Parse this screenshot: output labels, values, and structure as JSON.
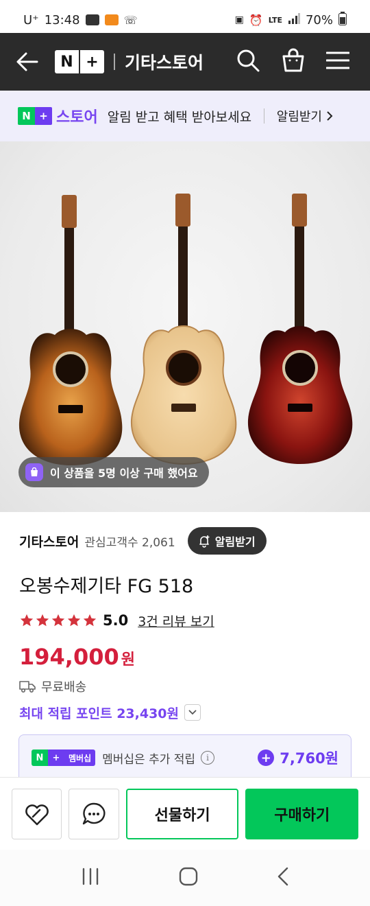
{
  "status_bar": {
    "carrier": "U⁺",
    "time": "13:48",
    "network": "LTE",
    "battery": "70%"
  },
  "header": {
    "logo_left": "N",
    "logo_right": "+",
    "title": "기타스토어"
  },
  "promo": {
    "logo_left": "N",
    "logo_right": "+",
    "store_label": "스토어",
    "message": "알림 받고 혜택 받아보세요",
    "notify_label": "알림받기"
  },
  "hero": {
    "purchase_badge": "이 상품을 5명 이상 구매 했어요"
  },
  "store": {
    "name": "기타스토어",
    "fans": "관심고객수 2,061",
    "alarm_label": "알림받기"
  },
  "product": {
    "title": "오봉수제기타 FG 518",
    "rating": 5.0,
    "rating_text": "5.0",
    "review_link": "3건 리뷰 보기",
    "price": "194,000",
    "currency": "원",
    "shipping": "무료배송",
    "max_points": "최대 적립 포인트 23,430원"
  },
  "membership": {
    "badge_g": "N",
    "badge_p": "+",
    "badge_text": "멤버십",
    "text": "멤버십은 추가 적립",
    "points": "7,760원"
  },
  "actions": {
    "gift_label": "선물하기",
    "buy_label": "구매하기"
  },
  "colors": {
    "naver_green": "#03c75a",
    "purple": "#6d3cf0",
    "price_red": "#d41f3c",
    "header_dark": "#2b2b2b"
  }
}
